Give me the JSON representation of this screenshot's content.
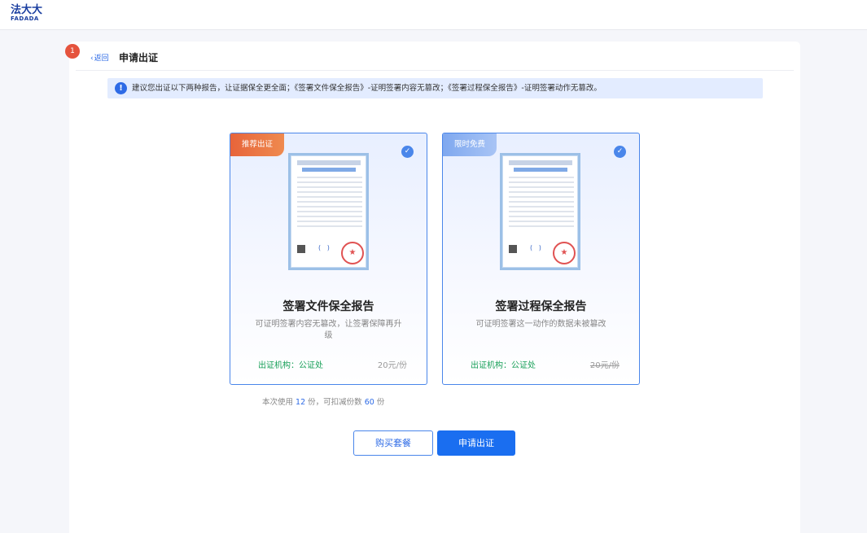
{
  "brand": {
    "name_cn": "法大大",
    "name_en": "FADADA"
  },
  "notification_count": "1",
  "header": {
    "back_label": "返回",
    "title": "申请出证"
  },
  "tip": {
    "text": "建议您出证以下两种报告，让证据保全更全面；《签署文件保全报告》-证明签署内容无篡改；《签署过程保全报告》-证明签署动作无篡改。"
  },
  "cards": [
    {
      "ribbon": "推荐出证",
      "name": "签署文件保全报告",
      "desc": "可证明签署内容无篡改，让签署保障再升级",
      "org": "出证机构：公证处",
      "price": "20元/份",
      "selected": true,
      "price_struck": false
    },
    {
      "ribbon": "限时免费",
      "name": "签署过程保全报告",
      "desc": "可证明签署这一动作的数据未被篡改",
      "org": "出证机构：公证处",
      "price": "20元/份",
      "selected": true,
      "price_struck": true
    }
  ],
  "usage": {
    "prefix": "本次使用",
    "used": "12",
    "middle": "份，可扣减份数",
    "available": "60",
    "suffix": "份"
  },
  "buttons": {
    "buy": "购买套餐",
    "apply": "申请出证"
  },
  "colors": {
    "accent": "#1a6ef0",
    "org_green": "#18a058",
    "ribbon_orange": "#e7643a",
    "ribbon_blue": "#7fa8ef",
    "badge_red": "#e5533d"
  }
}
